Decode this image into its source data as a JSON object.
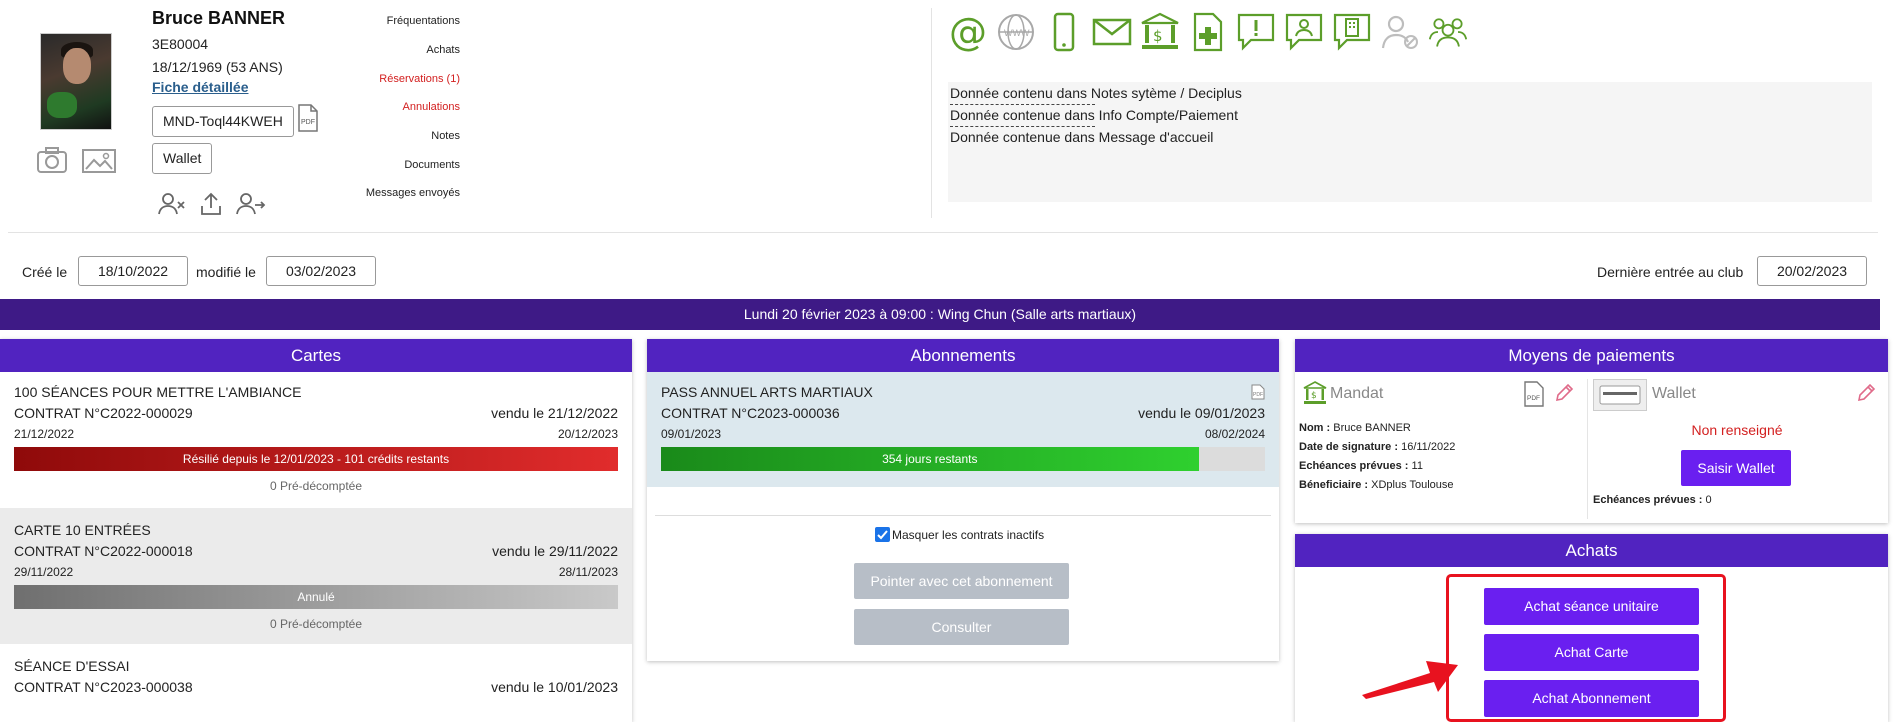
{
  "profile": {
    "name": "Bruce BANNER",
    "code": "3E80004",
    "birth": "18/12/1969 (53 ANS)",
    "fiche_label": "Fiche détaillée",
    "mandate_ref": "MND-Toql44KWEH",
    "wallet_label": "Wallet"
  },
  "side_menu": {
    "items": [
      "Fréquentations",
      "Achats",
      "Réservations (1)",
      "Annulations",
      "Notes",
      "Documents",
      "Messages envoyés"
    ]
  },
  "notes": {
    "lines": [
      "Donnée contenu dans Notes sytème / Deciplus",
      "Donnée contenue dans Info Compte/Paiement",
      "Donnée contenue dans Message d'accueil"
    ]
  },
  "dates": {
    "created_label": "Créé le",
    "created": "18/10/2022",
    "modified_label": "modifié le",
    "modified": "03/02/2023",
    "last_entry_label": "Dernière entrée au club",
    "last_entry": "20/02/2023"
  },
  "banner": {
    "text": "Lundi 20 février 2023 à 09:00 : Wing Chun (Salle arts martiaux)"
  },
  "cartes": {
    "title": "Cartes",
    "items": [
      {
        "name": "100 SÉANCES POUR METTRE L'AMBIANCE",
        "contract": "CONTRAT N°C2022-000029",
        "sold": "vendu le 21/12/2022",
        "start": "21/12/2022",
        "end": "20/12/2023",
        "status": "Résilié depuis le 12/01/2023 - 101 crédits restants",
        "pre": "0 Pré-décomptée"
      },
      {
        "name": "CARTE 10 ENTRÉES",
        "contract": "CONTRAT N°C2022-000018",
        "sold": "vendu le 29/11/2022",
        "start": "29/11/2022",
        "end": "28/11/2023",
        "status": "Annulé",
        "pre": "0 Pré-décomptée"
      },
      {
        "name": "SÉANCE D'ESSAI",
        "contract": "CONTRAT N°C2023-000038",
        "sold": "vendu le 10/01/2023"
      }
    ]
  },
  "abonnements": {
    "title": "Abonnements",
    "item": {
      "name": "PASS ANNUEL ARTS MARTIAUX",
      "contract": "CONTRAT N°C2023-000036",
      "sold": "vendu le 09/01/2023",
      "start": "09/01/2023",
      "end": "08/02/2024",
      "remaining": "354 jours restants",
      "progress": 0.89
    },
    "mask_label": "Masquer les contrats inactifs",
    "pointer_label": "Pointer avec cet abonnement",
    "consult_label": "Consulter"
  },
  "paiements": {
    "title": "Moyens de paiements",
    "mandat_title": "Mandat",
    "nom_label": "Nom :",
    "nom": "Bruce BANNER",
    "sig_label": "Date de signature :",
    "sig": "16/11/2022",
    "ech_label": "Echéances prévues :",
    "ech": "11",
    "benef_label": "Béneficiaire :",
    "benef": "XDplus Toulouse",
    "wallet_title": "Wallet",
    "wallet_status": "Non renseigné",
    "wallet_btn": "Saisir Wallet",
    "wallet_ech_label": "Echéances prévues :",
    "wallet_ech": "0"
  },
  "achats": {
    "title": "Achats",
    "buttons": [
      "Achat séance unitaire",
      "Achat Carte",
      "Achat Abonnement"
    ]
  },
  "colors": {
    "accent": "#5123c0",
    "banner": "#3e1a86",
    "green": "#5c9e2a",
    "red_alert": "#d32020"
  }
}
